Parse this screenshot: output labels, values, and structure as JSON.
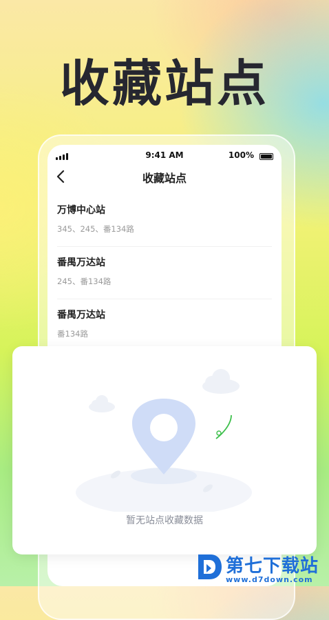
{
  "headline": "收藏站点",
  "status_bar": {
    "time": "9:41 AM",
    "battery": "100%"
  },
  "nav": {
    "title": "收藏站点"
  },
  "stations": [
    {
      "name": "万博中心站",
      "routes": "345、245、番134路"
    },
    {
      "name": "番禺万达站",
      "routes": "245、番134路"
    },
    {
      "name": "番禺万达站",
      "routes": "番134路"
    }
  ],
  "empty_state": {
    "message": "暂无站点收藏数据"
  },
  "watermark": {
    "title": "第七下载站",
    "url": "www.d7down.com"
  },
  "colors": {
    "pin": "#cfdcf7",
    "accent_green": "#3cbf4a",
    "watermark_blue": "#1f6fd8"
  },
  "icons": [
    "back-arrow-icon",
    "signal-icon",
    "battery-icon",
    "location-pin-icon",
    "cloud-icon",
    "leaf-icon"
  ]
}
